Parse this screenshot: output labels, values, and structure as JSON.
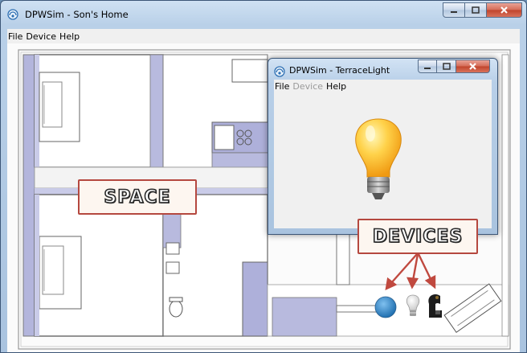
{
  "main_window": {
    "title": "DPWSim - Son's Home",
    "menu": [
      "File",
      "Device",
      "Help"
    ]
  },
  "device_window": {
    "title": "DPWSim - TerraceLight",
    "menu": [
      {
        "label": "File",
        "enabled": true
      },
      {
        "label": "Device",
        "enabled": false
      },
      {
        "label": "Help",
        "enabled": true
      }
    ],
    "device_icon": "light-bulb-on-icon"
  },
  "annotations": {
    "space_label": "SPACE",
    "devices_label": "DEVICES"
  },
  "devices_on_plan": [
    {
      "icon": "blue-sphere-device-icon"
    },
    {
      "icon": "light-bulb-off-icon"
    },
    {
      "icon": "coffee-machine-icon"
    }
  ],
  "colors": {
    "callout_border": "#b5483f",
    "arrow": "#c0493f",
    "plan_accent": "#a9abd6",
    "bulb": "#f6b320"
  }
}
